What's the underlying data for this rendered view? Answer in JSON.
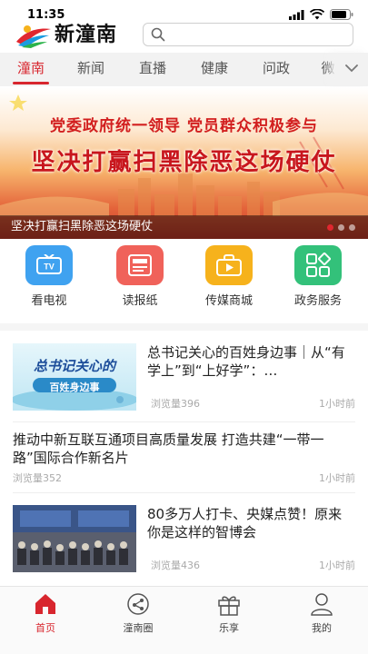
{
  "status_bar": {
    "time": "11:35"
  },
  "header": {
    "app_name": "新潼南",
    "search_placeholder": ""
  },
  "tabs": [
    {
      "label": "潼南",
      "active": true
    },
    {
      "label": "新闻"
    },
    {
      "label": "直播"
    },
    {
      "label": "健康"
    },
    {
      "label": "问政"
    },
    {
      "label": "微"
    }
  ],
  "banner": {
    "line1": "党委政府统一领导  党员群众积极参与",
    "line2": "坚决打赢扫黑除恶这场硬仗",
    "caption": "坚决打赢扫黑除恶这场硬仗",
    "slide_count": 3,
    "active_slide": 1
  },
  "services": [
    {
      "label": "看电视",
      "icon": "tv-icon",
      "color": "#3fa2f0"
    },
    {
      "label": "读报纸",
      "icon": "newspaper-icon",
      "color": "#f0625a"
    },
    {
      "label": "传媒商城",
      "icon": "shopping-bag-icon",
      "color": "#f6b21c"
    },
    {
      "label": "政务服务",
      "icon": "government-service-icon",
      "color": "#33c17a"
    }
  ],
  "news": [
    {
      "title": "总书记关心的百姓身边事｜从“有学上”到“上好学”：…",
      "views": "浏览量396",
      "time": "1小时前",
      "thumb_text": "总书记关心的",
      "thumb_sub": "百姓身边事"
    },
    {
      "title": "推动中新互联互通项目高质量发展 打造共建“一带一路”国际合作新名片",
      "views": "浏览量352",
      "time": "1小时前"
    },
    {
      "title": "80多万人打卡、央媒点赞！原来你是这样的智博会",
      "views": "浏览量436",
      "time": "1小时前"
    }
  ],
  "bottom_nav": [
    {
      "label": "首页",
      "icon": "home-icon",
      "active": true
    },
    {
      "label": "潼南圈",
      "icon": "share-circle-icon"
    },
    {
      "label": "乐享",
      "icon": "gift-icon"
    },
    {
      "label": "我的",
      "icon": "user-icon"
    }
  ],
  "colors": {
    "accent": "#d8262e"
  }
}
